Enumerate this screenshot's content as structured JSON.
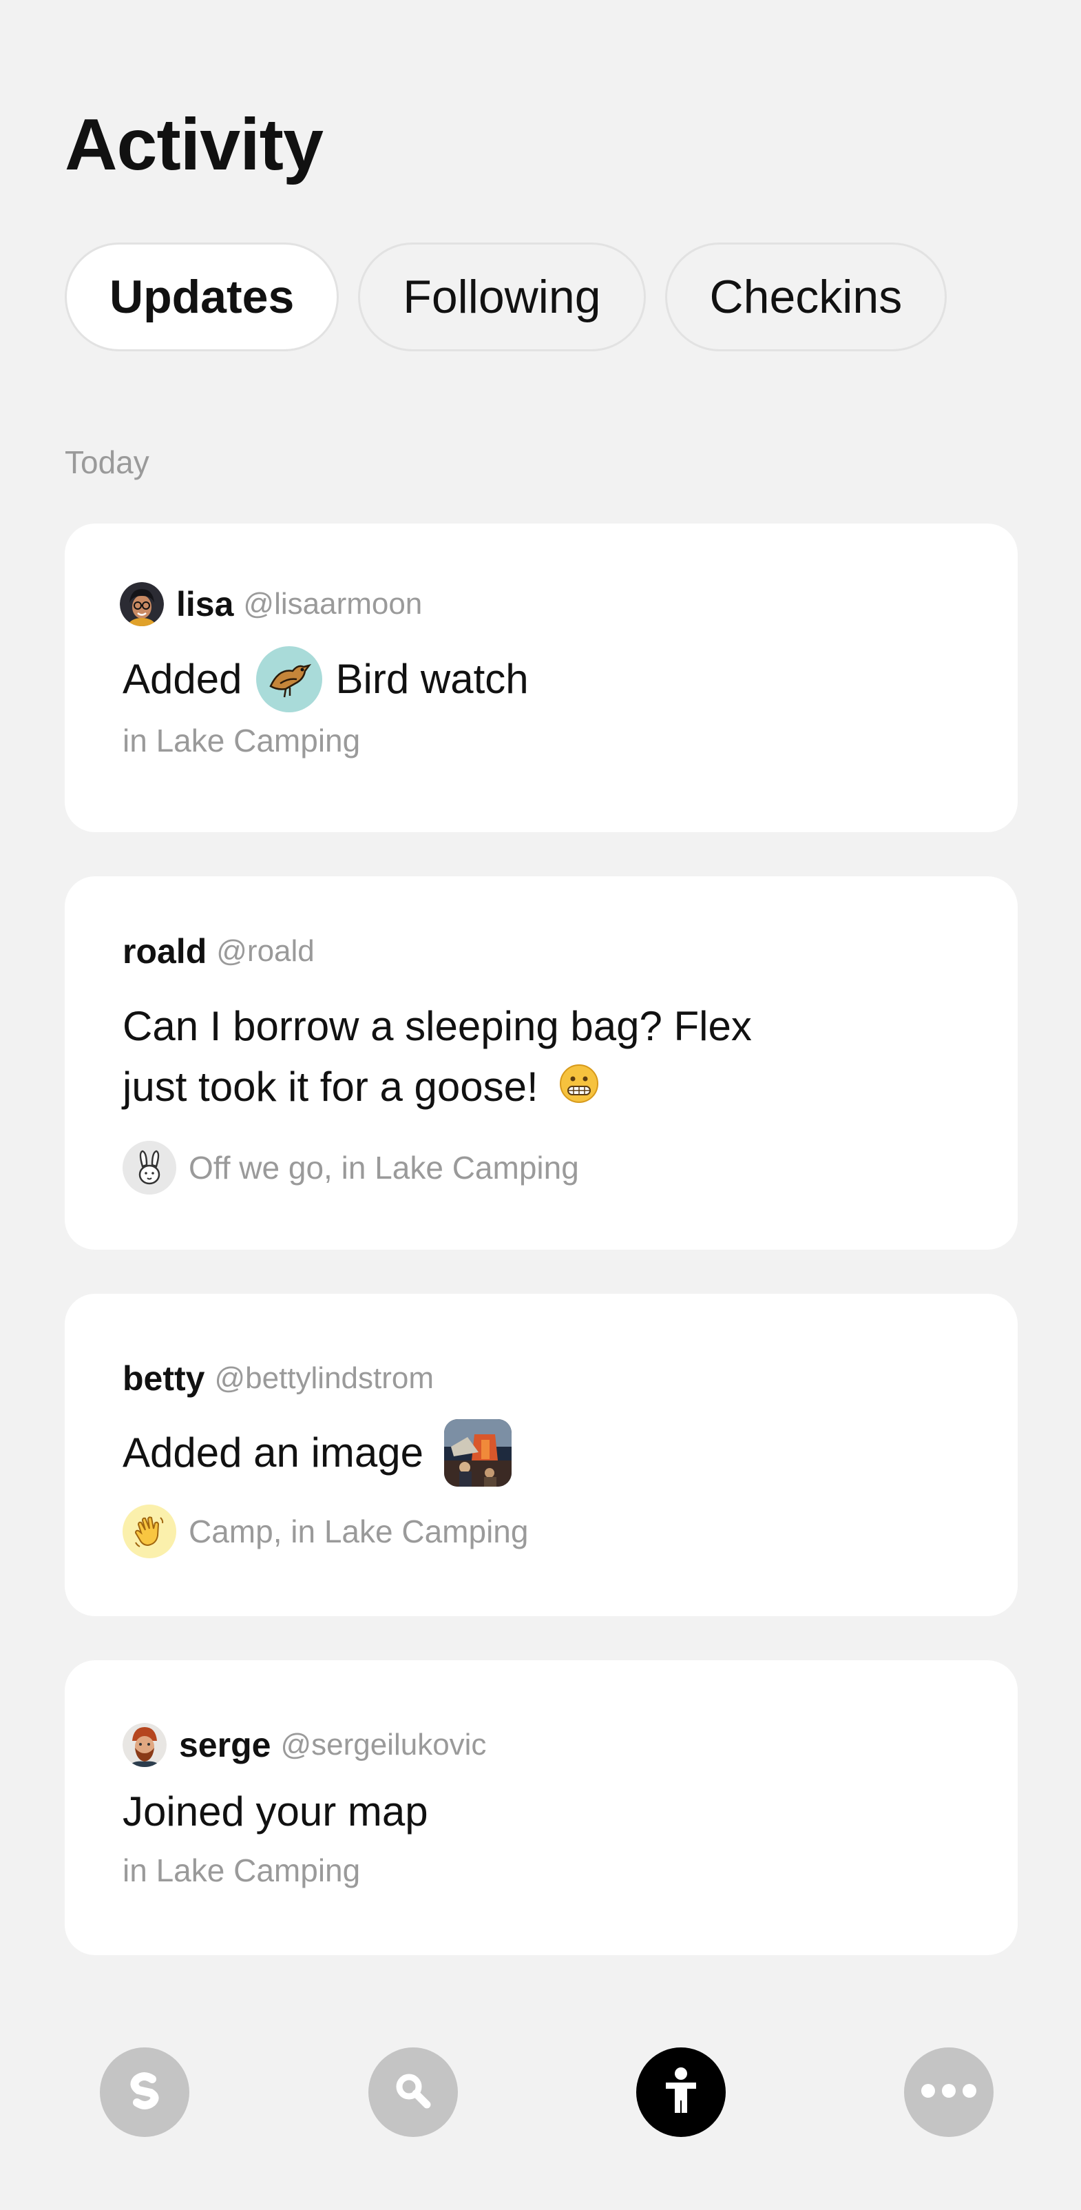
{
  "header": {
    "title": "Activity"
  },
  "tabs": [
    {
      "label": "Updates",
      "active": true
    },
    {
      "label": "Following",
      "active": false
    },
    {
      "label": "Checkins",
      "active": false
    }
  ],
  "section": {
    "label": "Today"
  },
  "feed": [
    {
      "name": "lisa",
      "handle": "@lisaarmoon",
      "text_before": "Added",
      "activity": "Bird watch",
      "context": "in Lake Camping",
      "icon": "bird-icon"
    },
    {
      "name": "roald",
      "handle": "@roald",
      "text": "Can I borrow a sleeping bag? Flex just took it for a goose!",
      "emoji": "grimacing-face-icon",
      "context": "Off we go, in Lake Camping",
      "icon": "rabbit-icon"
    },
    {
      "name": "betty",
      "handle": "@bettylindstrom",
      "text": "Added an image",
      "context": "Camp, in Lake Camping",
      "icon": "waving-hand-icon"
    },
    {
      "name": "serge",
      "handle": "@sergeilukovic",
      "text": "Joined your map",
      "context": "in Lake Camping"
    }
  ],
  "nav": [
    {
      "icon": "home-logo-icon",
      "active": false
    },
    {
      "icon": "search-icon",
      "active": false
    },
    {
      "icon": "activity-person-icon",
      "active": true
    },
    {
      "icon": "more-icon",
      "active": false
    }
  ],
  "colors": {
    "background": "#f2f2f2",
    "card": "#ffffff",
    "muted": "#9a9a9a",
    "active_nav": "#000000"
  }
}
